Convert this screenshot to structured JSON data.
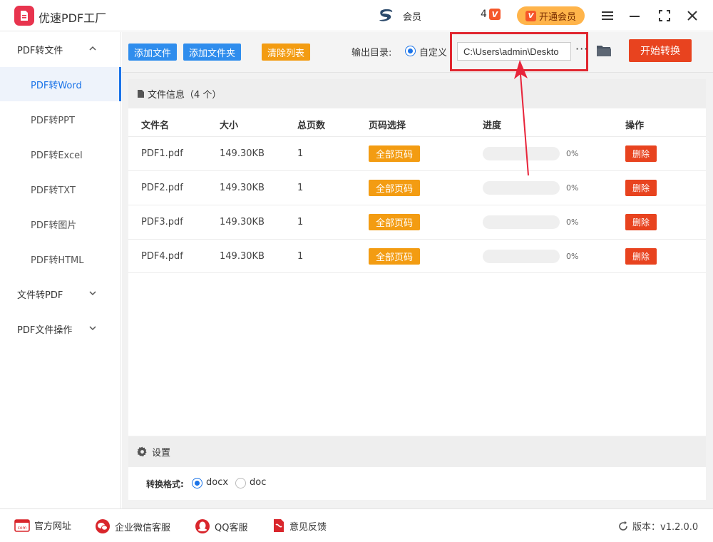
{
  "app": {
    "title": "优速PDF工厂",
    "user_name": "会员",
    "vip_level": "4",
    "vip_badge": "V",
    "vip_button": "开通会员",
    "brand_color": "#e8344e"
  },
  "sidebar": {
    "groups": [
      {
        "label": "PDF转文件",
        "expanded": true
      },
      {
        "label": "文件转PDF",
        "expanded": false
      },
      {
        "label": "PDF文件操作",
        "expanded": false
      }
    ],
    "items": [
      {
        "label": "PDF转Word",
        "active": true
      },
      {
        "label": "PDF转PPT"
      },
      {
        "label": "PDF转Excel"
      },
      {
        "label": "PDF转TXT"
      },
      {
        "label": "PDF转图片"
      },
      {
        "label": "PDF转HTML"
      }
    ]
  },
  "toolbar": {
    "add_file": "添加文件",
    "add_folder": "添加文件夹",
    "clear_list": "清除列表",
    "output_label": "输出目录:",
    "custom_label": "自定义",
    "output_path": "C:\\Users\\admin\\Deskto",
    "more": "···",
    "start": "开始转换"
  },
  "file_panel": {
    "title": "文件信息（4 个）",
    "columns": [
      "文件名",
      "大小",
      "总页数",
      "页码选择",
      "进度",
      "操作"
    ],
    "rows": [
      {
        "name": "PDF1.pdf",
        "size": "149.30KB",
        "pages": "1",
        "page_sel": "全部页码",
        "progress": 0,
        "progress_text": "0%",
        "action": "删除"
      },
      {
        "name": "PDF2.pdf",
        "size": "149.30KB",
        "pages": "1",
        "page_sel": "全部页码",
        "progress": 0,
        "progress_text": "0%",
        "action": "删除"
      },
      {
        "name": "PDF3.pdf",
        "size": "149.30KB",
        "pages": "1",
        "page_sel": "全部页码",
        "progress": 0,
        "progress_text": "0%",
        "action": "删除"
      },
      {
        "name": "PDF4.pdf",
        "size": "149.30KB",
        "pages": "1",
        "page_sel": "全部页码",
        "progress": 0,
        "progress_text": "0%",
        "action": "删除"
      }
    ]
  },
  "settings": {
    "title": "设置",
    "format_label": "转换格式:",
    "options": [
      {
        "label": "docx",
        "selected": true
      },
      {
        "label": "doc",
        "selected": false
      }
    ]
  },
  "footer": {
    "links": [
      "官方网址",
      "企业微信客服",
      "QQ客服",
      "意见反馈"
    ],
    "version_label": "版本：v1.2.0.0"
  },
  "colors": {
    "accent_blue": "#1a73e8",
    "orange": "#f39c12",
    "red": "#e8431f"
  }
}
